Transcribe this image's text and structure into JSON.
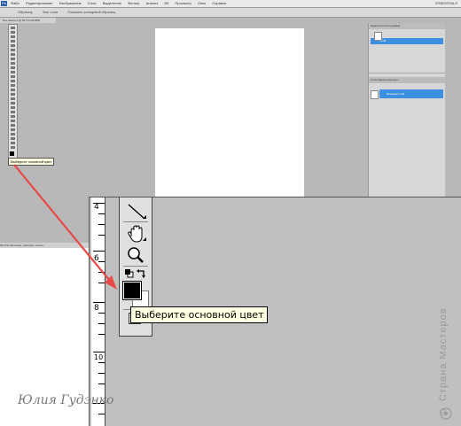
{
  "screen": {
    "menu": [
      "Файл",
      "Редактирование",
      "Изображение",
      "Слои",
      "Выделение",
      "Фильтр",
      "Анализ",
      "3D",
      "Просмотр",
      "Окно",
      "Справка"
    ],
    "ps_logo": "Ps",
    "workspace_label": "ESSENTIALS",
    "options_bar": [
      "Образец:",
      "Все слои",
      "Показать кольцевой образец"
    ],
    "document_tab": "Без имени-1 @ 66,7% (RGB/8)",
    "small_tooltip": "Выберите основной цвет",
    "panel_tabs": "Навигатор   Гистограмма",
    "panel_highlight": "Слой",
    "layers_tabs": "Слои   Каналы   Контуры",
    "layers_highlight": "Фоновый слой",
    "status": "66,67%   Экспонир. работает только..."
  },
  "zoom": {
    "ruler_numbers": [
      "4",
      "6",
      "8",
      "10"
    ],
    "tooltip": "Выберите основной цвет",
    "icons": [
      "line-tool-icon",
      "hand-tool-icon",
      "zoom-tool-icon",
      "default-colors-icon",
      "swap-colors-icon",
      "foreground-color-swatch",
      "background-color-swatch",
      "quick-mask-icon"
    ]
  },
  "colors": {
    "screen_bg": "#b8b8b8",
    "zoom_bg": "#c0c0c0",
    "highlight": "#3d8fe0",
    "arrow": "#e84a4a",
    "tooltip_bg": "#ffffe1"
  },
  "watermark": {
    "text": "© Страна Мастеров",
    "signature": "Юлия Гудэнко"
  }
}
